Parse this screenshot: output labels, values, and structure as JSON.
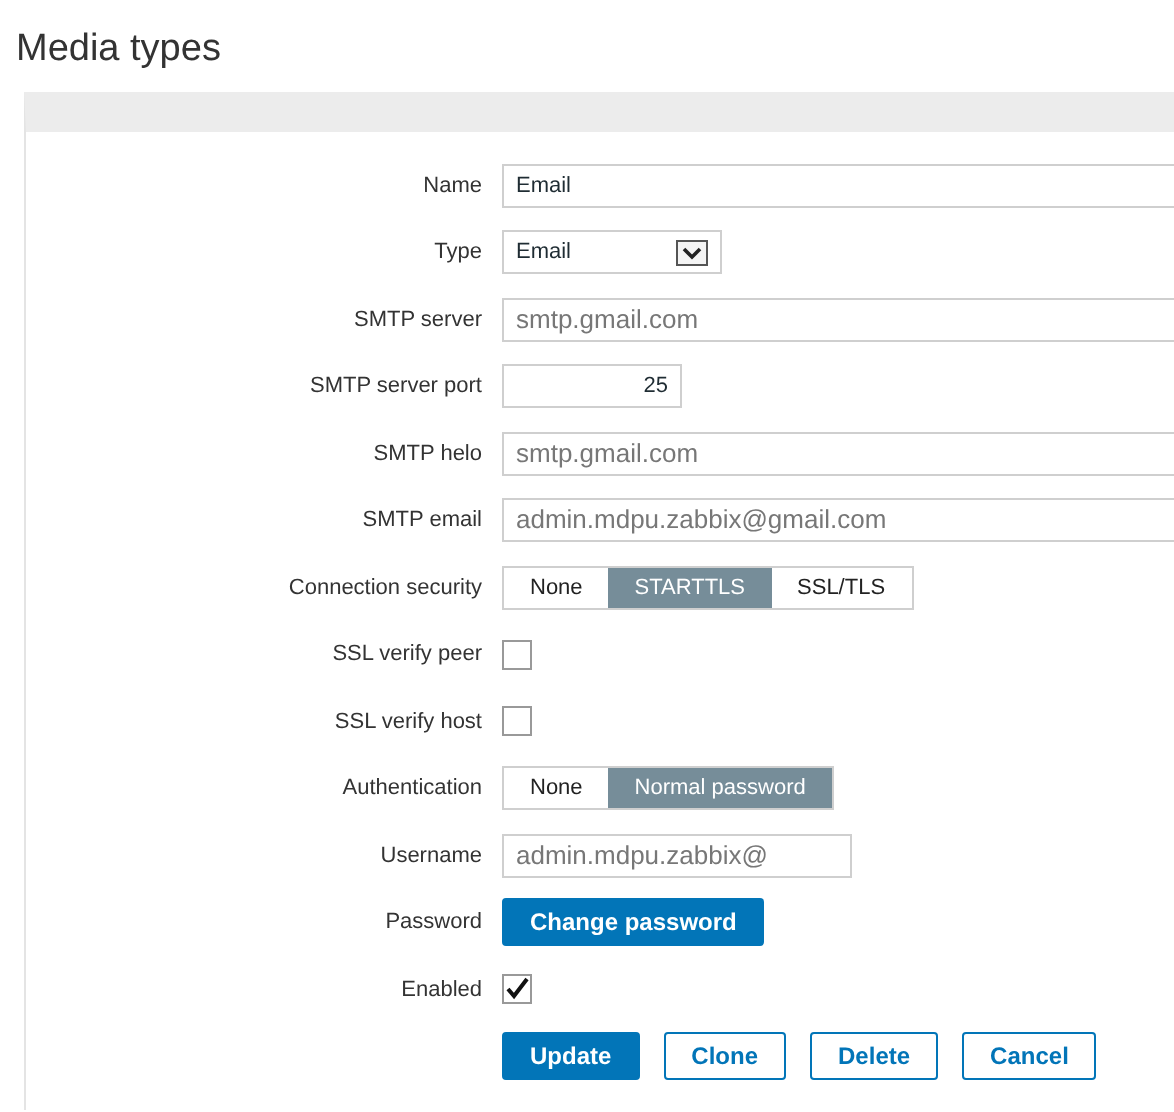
{
  "title": "Media types",
  "fields": [
    {
      "label": "Name",
      "kind": "text",
      "value": "Email",
      "muted": false
    },
    {
      "label": "Type",
      "kind": "select",
      "value": "Email"
    },
    {
      "label": "SMTP server",
      "kind": "text",
      "value": "smtp.gmail.com",
      "muted": true
    },
    {
      "label": "SMTP server port",
      "kind": "number",
      "value": "25"
    },
    {
      "label": "SMTP helo",
      "kind": "text",
      "value": "smtp.gmail.com",
      "muted": true
    },
    {
      "label": "SMTP email",
      "kind": "text",
      "value": "admin.mdpu.zabbix@gmail.com",
      "muted": true
    },
    {
      "label": "Connection security",
      "kind": "segmented",
      "options": [
        {
          "label": "None",
          "selected": false
        },
        {
          "label": "STARTTLS",
          "selected": true
        },
        {
          "label": "SSL/TLS",
          "selected": false
        }
      ]
    },
    {
      "label": "SSL verify peer",
      "kind": "checkbox",
      "checked": false
    },
    {
      "label": "SSL verify host",
      "kind": "checkbox",
      "checked": false
    },
    {
      "label": "Authentication",
      "kind": "segmented",
      "options": [
        {
          "label": "None",
          "selected": false
        },
        {
          "label": "Normal password",
          "selected": true
        }
      ]
    },
    {
      "label": "Username",
      "kind": "short_text",
      "value": "admin.mdpu.zabbix@",
      "muted": true
    },
    {
      "label": "Password",
      "kind": "button",
      "value": "Change password"
    },
    {
      "label": "Enabled",
      "kind": "checkbox",
      "checked": true
    }
  ],
  "buttons": [
    {
      "label": "Update",
      "primary": true
    },
    {
      "label": "Clone",
      "primary": false
    },
    {
      "label": "Delete",
      "primary": false
    },
    {
      "label": "Cancel",
      "primary": false
    }
  ]
}
